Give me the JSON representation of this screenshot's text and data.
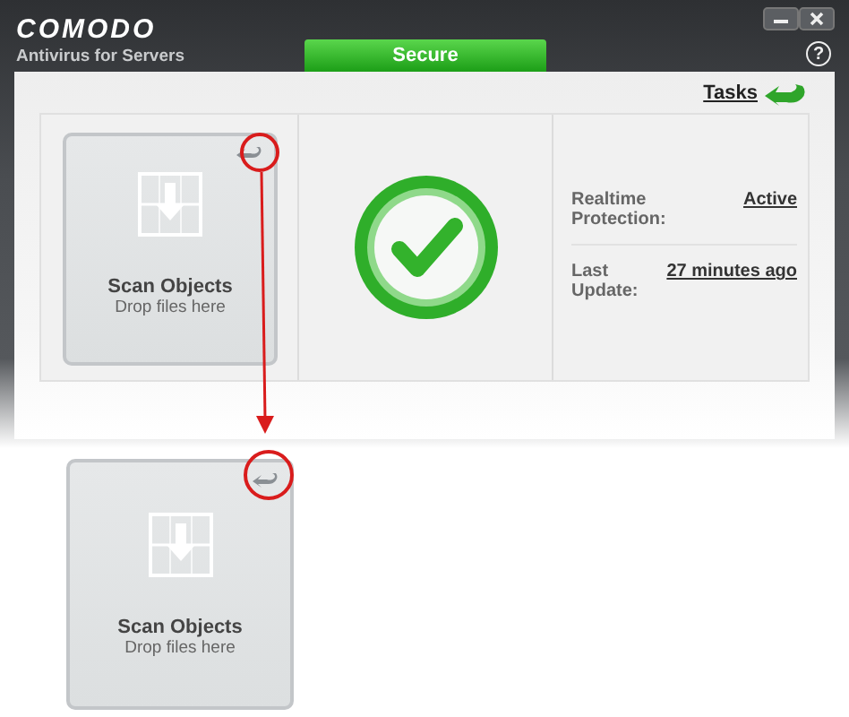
{
  "window": {
    "brand": "COMODO",
    "product": "Antivirus for Servers",
    "status_tab": "Secure",
    "help_button": "?"
  },
  "tasks_link": "Tasks",
  "scan_tile": {
    "title": "Scan Objects",
    "hint": "Drop files here"
  },
  "status_rows": [
    {
      "label": "Realtime Protection:",
      "value": "Active"
    },
    {
      "label": "Last Update:",
      "value": "27 minutes ago"
    }
  ],
  "callout_tile": {
    "title": "Scan Objects",
    "hint": "Drop files here"
  }
}
